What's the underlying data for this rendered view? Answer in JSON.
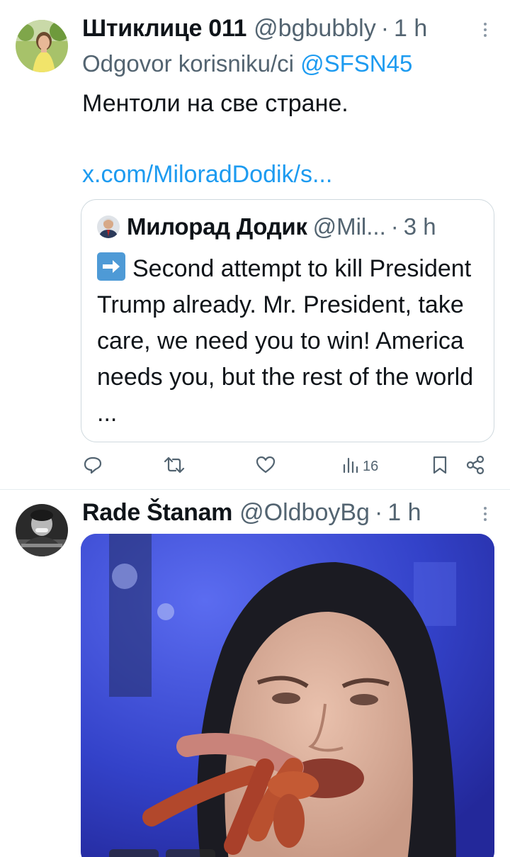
{
  "tweets": [
    {
      "display_name": "Штиклице 011",
      "handle": "@bgbubbly",
      "separator": "·",
      "time": "1 h",
      "reply_prefix": "Odgovor korisniku/ci",
      "reply_mention": "@SFSN45",
      "text": "Ментоли на све стране.",
      "link": "x.com/MiloradDodik/s...",
      "quote": {
        "display_name": "Милорад Додик",
        "handle": "@Mil...",
        "separator": "·",
        "time": "3 h",
        "text": "Second attempt to kill President Trump already. Mr. President, take care, we need you to win!  America needs you, but the rest of the world ..."
      },
      "actions": {
        "views": "16"
      }
    },
    {
      "display_name": "Rade Štanam",
      "handle": "@OldboyBg",
      "separator": "·",
      "time": "1 h"
    }
  ],
  "colors": {
    "link": "#1d9bf0",
    "secondary_text": "#536471",
    "divider": "#e6ecf0"
  },
  "icons": [
    "more-icon",
    "reply-icon",
    "retweet-icon",
    "like-icon",
    "views-icon",
    "bookmark-icon",
    "share-icon",
    "arrow-right-emoji"
  ]
}
